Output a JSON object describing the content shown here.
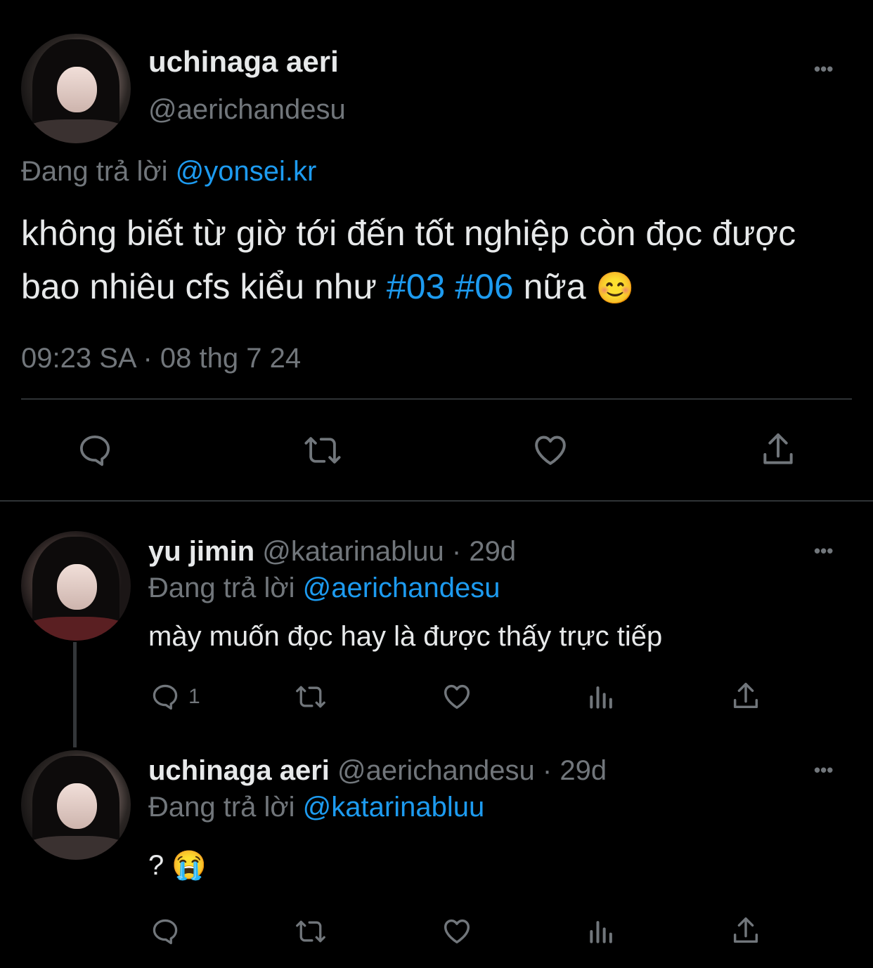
{
  "main_tweet": {
    "display_name": "uchinaga aeri",
    "handle": "@aerichandesu",
    "reply_label": "Đang trả lời",
    "reply_to": "@yonsei.kr",
    "text_part1": "không biết từ giờ tới đến tốt nghiệp còn đọc được bao nhiêu cfs kiểu như ",
    "hashtag1": "#03",
    "hashtag2": "#06",
    "text_part2": " nữa ",
    "emoji": "😊",
    "timestamp": "09:23 SA · 08 thg 7 24",
    "more": "•••"
  },
  "reply1": {
    "display_name": "yu jimin",
    "meta": "@katarinabluu · 29d",
    "reply_label": "Đang trả lời",
    "reply_to": "@aerichandesu",
    "text": "mày muốn đọc hay là được thấy trực tiếp",
    "reply_count": "1",
    "more": "•••"
  },
  "reply2": {
    "display_name": "uchinaga aeri",
    "meta": "@aerichandesu · 29d",
    "reply_label": "Đang trả lời",
    "reply_to": "@katarinabluu",
    "text": "? 😭",
    "more": "•••"
  },
  "colors": {
    "background": "#000000",
    "text": "#e7e9ea",
    "muted": "#71767b",
    "accent": "#1d9bf0",
    "divider": "#2f3336"
  },
  "icons": [
    "reply-icon",
    "retweet-icon",
    "like-icon",
    "share-icon",
    "views-icon",
    "more-icon"
  ]
}
